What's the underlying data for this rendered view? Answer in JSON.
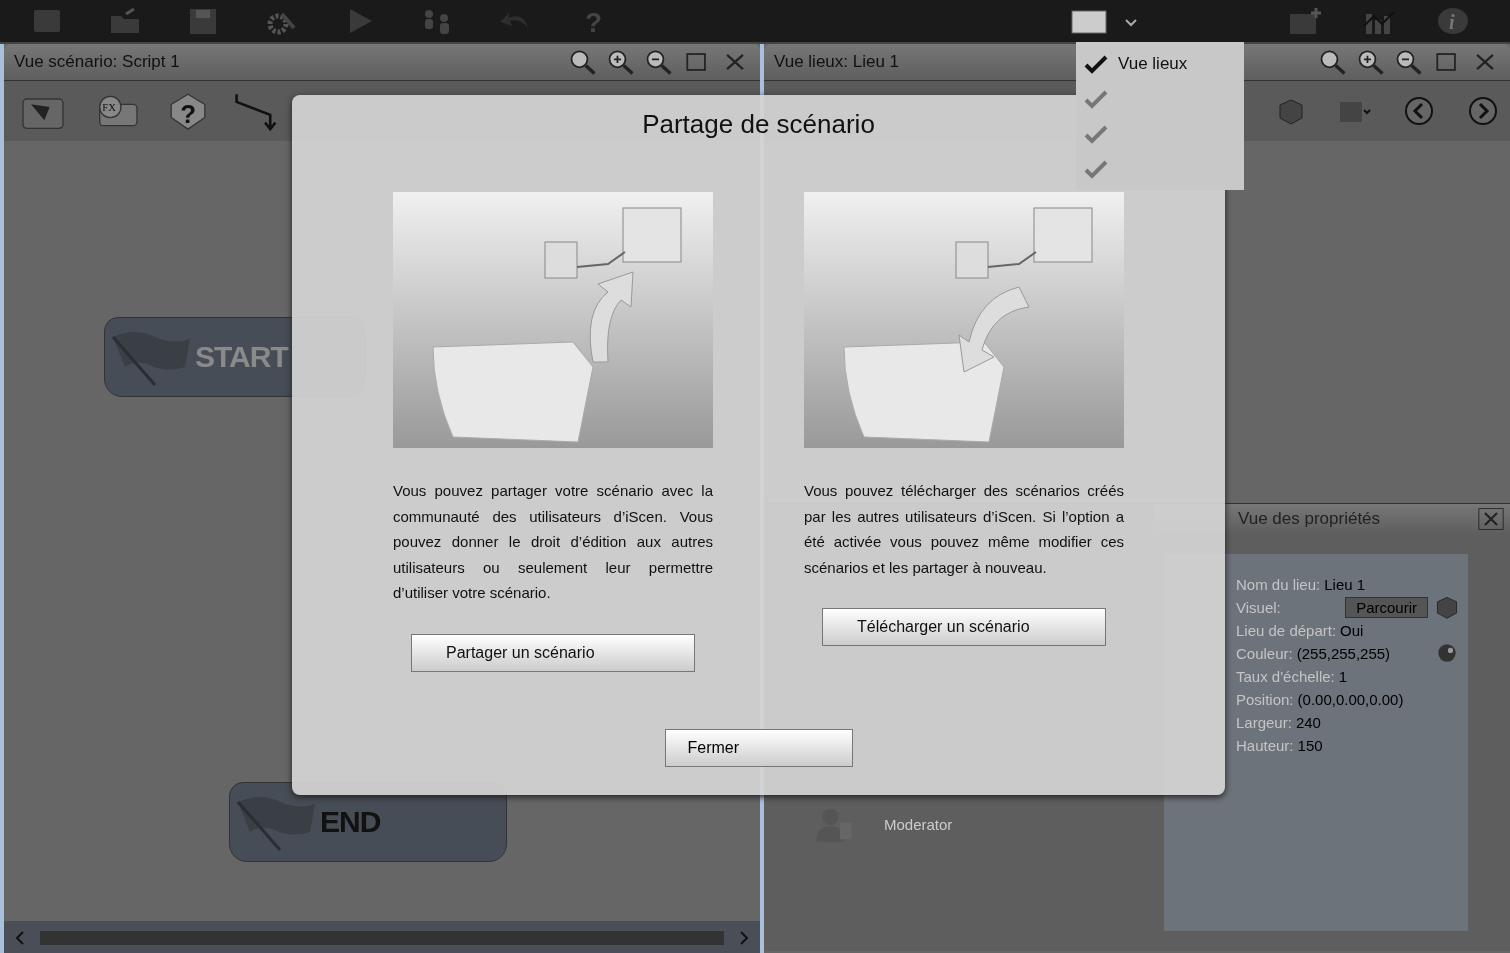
{
  "toolbar": {
    "help_text": "?",
    "info_text": "i"
  },
  "scenario_panel": {
    "title": "Vue scénario: Script 1",
    "tools": {
      "fx_text": "FX",
      "help_text": "?"
    },
    "nodes": [
      {
        "kind": "start",
        "label": "START"
      },
      {
        "kind": "end",
        "label": "END"
      }
    ]
  },
  "places_panel": {
    "title": "Vue lieux: Lieu 1"
  },
  "view_menu": {
    "items": [
      {
        "label": "Vue lieux",
        "checked": true
      },
      {
        "checked": true
      },
      {
        "checked": true
      },
      {
        "checked": true
      }
    ]
  },
  "users_panel": {
    "user": "Moderator"
  },
  "properties_panel": {
    "title": "Vue des propriétés",
    "browse_button": "Parcourir",
    "rows": [
      {
        "label": "Nom du lieu:",
        "value": "Lieu 1"
      },
      {
        "label": "Visuel:",
        "kind": "browse"
      },
      {
        "label": "Lieu de départ:",
        "value": "Oui"
      },
      {
        "label": "Couleur:",
        "value": "(255,255,255)",
        "kind": "color"
      },
      {
        "label": "Taux d'échelle:",
        "value": "1"
      },
      {
        "label": "Position:",
        "value": "(0.00,0.00,0.00)"
      },
      {
        "label": "Largeur:",
        "value": "240"
      },
      {
        "label": "Hauteur:",
        "value": "150"
      }
    ]
  },
  "dialog": {
    "title": "Partage de scénario",
    "options": [
      {
        "kind": "upload",
        "text": "Vous pouvez partager votre scénario avec la communauté des utilisateurs d’iScen. Vous pouvez donner le droit d’édition aux autres utilisateurs ou seulement leur permettre d’utiliser votre scénario.",
        "button": "Partager un scénario"
      },
      {
        "kind": "download",
        "text": "Vous pouvez télécharger des scénarios créés par les autres utilisateurs d’iScen. Si l’option a été activée vous pouvez même modifier ces scénarios et les partager à nouveau.",
        "button": "Télécharger un scénario"
      }
    ],
    "close_button": "Fermer"
  }
}
